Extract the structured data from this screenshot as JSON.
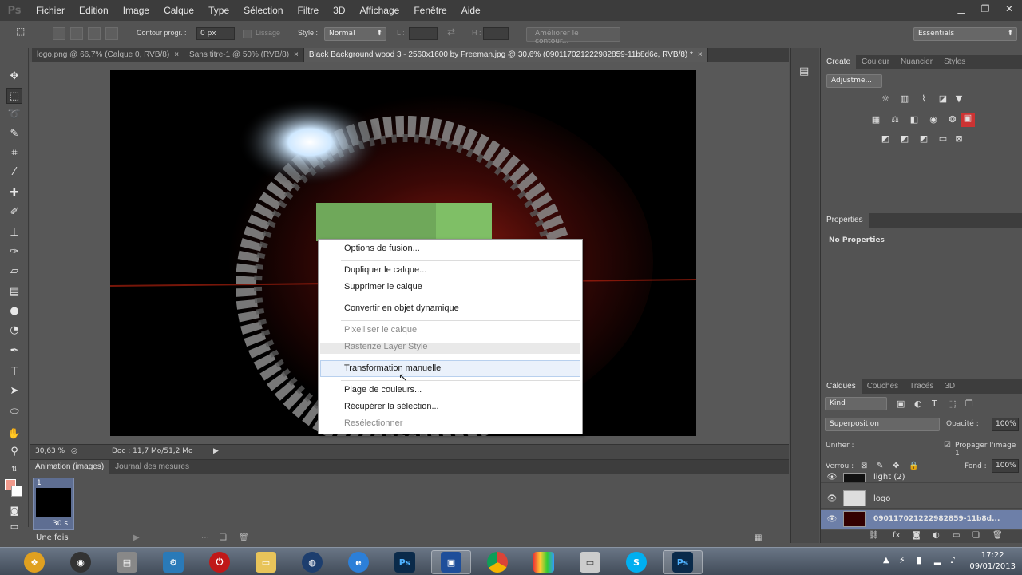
{
  "menubar": {
    "logo": "Ps",
    "items": [
      "Fichier",
      "Edition",
      "Image",
      "Calque",
      "Type",
      "Sélection",
      "Filtre",
      "3D",
      "Affichage",
      "Fenêtre",
      "Aide"
    ]
  },
  "options": {
    "feather_label": "Contour progr. :",
    "feather_value": "0 px",
    "antialias_label": "Lissage",
    "style_label": "Style :",
    "style_value": "Normal",
    "width_label": "L :",
    "height_label": "H :",
    "refine_button": "Améliorer le contour...",
    "workspace": "Essentials"
  },
  "tabs": [
    {
      "label": "logo.png @ 66,7% (Calque 0, RVB/8)",
      "close": "×"
    },
    {
      "label": "Sans titre-1 @ 50% (RVB/8)",
      "close": "×"
    },
    {
      "label": "Black Background wood 3 - 2560x1600 by Freeman.jpg @ 30,6% (09011702122298285​9-11b8d6c, RVB/8) *",
      "close": "×"
    }
  ],
  "status": {
    "zoom": "30,63 %",
    "doc": "Doc : 11,7 Mo/51,2 Mo"
  },
  "animation": {
    "tabs": [
      "Animation (images)",
      "Journal des mesures"
    ],
    "frame_number": "1",
    "frame_delay": "30 s",
    "loop": "Une fois"
  },
  "adjustments_panel": {
    "tabs": [
      "Create",
      "Couleur",
      "Nuancier",
      "Styles"
    ],
    "preset": "Adjustme..."
  },
  "properties_panel": {
    "title": "Properties",
    "empty": "No Properties"
  },
  "layers_panel": {
    "tabs": [
      "Calques",
      "Couches",
      "Tracés",
      "3D"
    ],
    "kind": "Kind",
    "blend": "Superposition",
    "opacity_label": "Opacité :",
    "opacity_value": "100%",
    "unify_label": "Unifier :",
    "propagate_label": "Propager l'image 1",
    "lock_label": "Verrou :",
    "fill_label": "Fond :",
    "fill_value": "100%",
    "layers": [
      {
        "name": "light (2)",
        "selected": false
      },
      {
        "name": "logo",
        "selected": false
      },
      {
        "name": "09011702122298285​9-11b8d...",
        "selected": true
      }
    ]
  },
  "context_menu": {
    "items": [
      {
        "label": "Options de fusion...",
        "disabled": false
      },
      {
        "label": "Dupliquer le calque...",
        "disabled": false
      },
      {
        "label": "Supprimer le calque",
        "disabled": false
      },
      {
        "label": "Convertir en objet dynamique",
        "disabled": false
      },
      {
        "label": "Pixelliser le calque",
        "disabled": true
      },
      {
        "label": "Rasterize Layer Style",
        "disabled": true
      },
      {
        "label": "Transformation manuelle",
        "disabled": false
      },
      {
        "label": "Plage de couleurs...",
        "disabled": false
      },
      {
        "label": "Récupérer la sélection...",
        "disabled": false
      },
      {
        "label": "Resélectionner",
        "disabled": true
      }
    ]
  },
  "taskbar": {
    "time": "17:22",
    "date": "09/01/2013",
    "ps_label": "Ps",
    "skype_label": "S"
  },
  "colors": {
    "accent_selection": "#6d7fa8",
    "foreground_swatch": "#f19a8c"
  }
}
